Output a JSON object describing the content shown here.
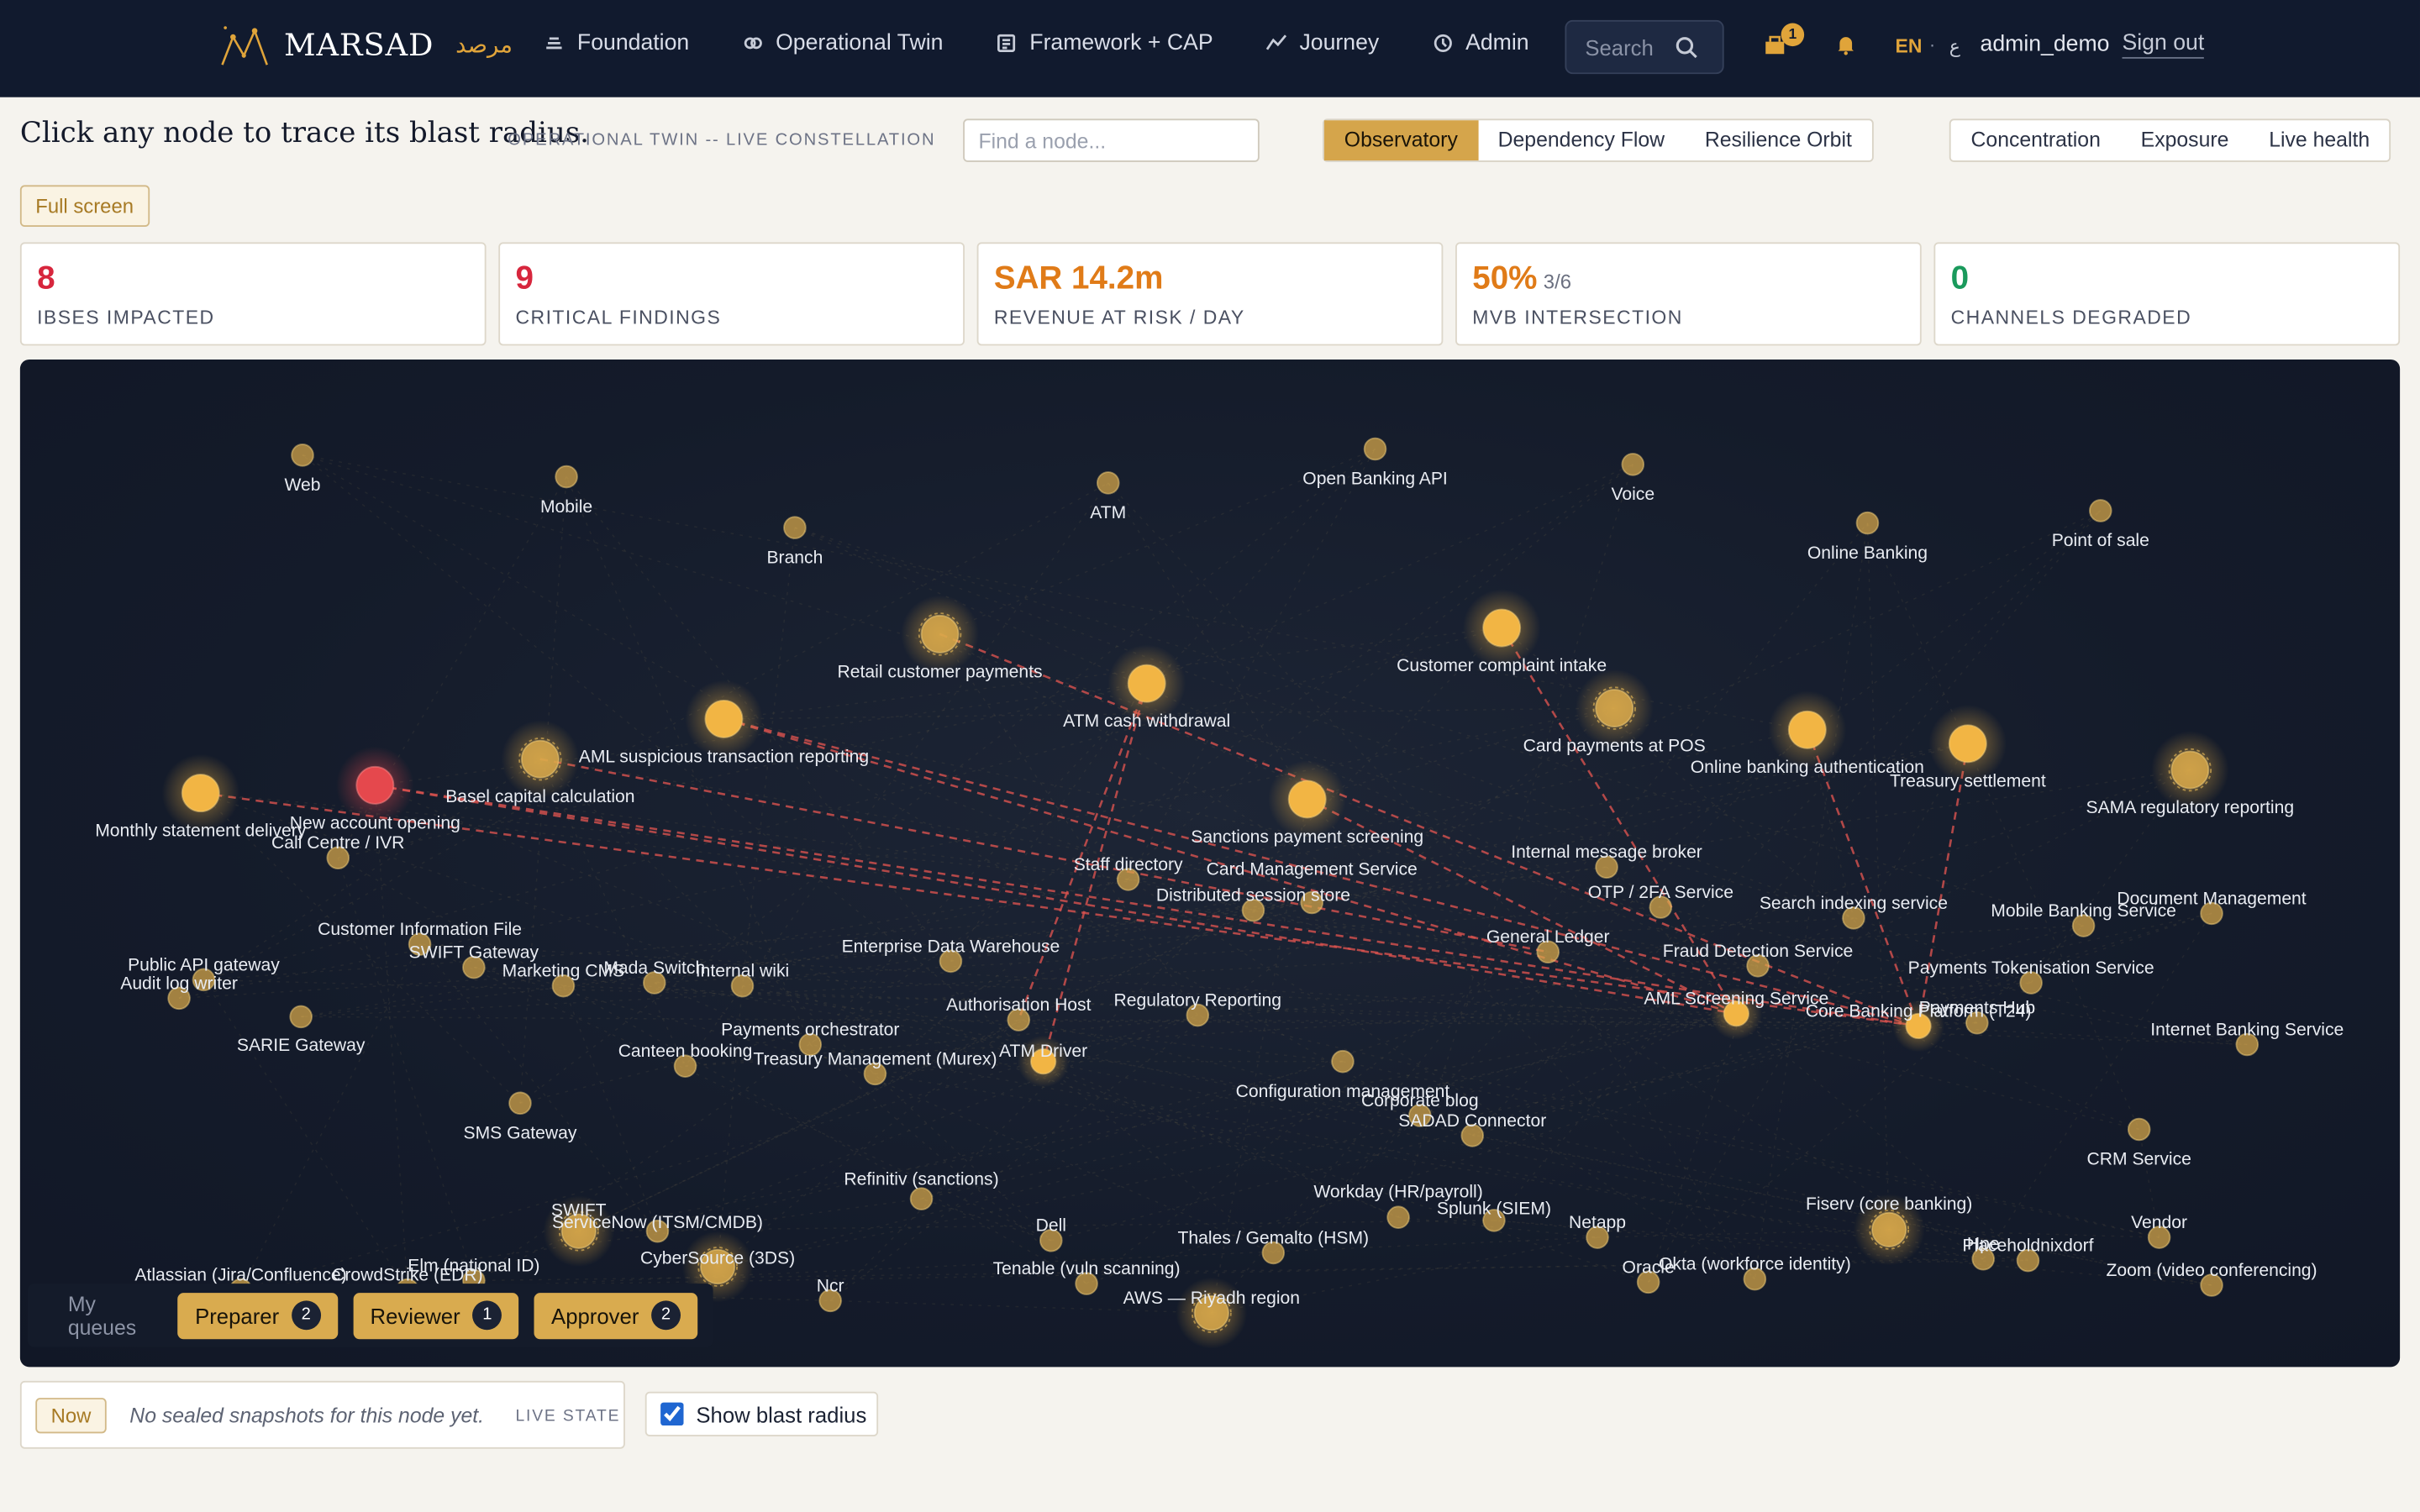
{
  "nav": {
    "brand": "MARSAD",
    "brand_ar": "مرصد",
    "links": [
      {
        "label": "Foundation",
        "icon": "layers-icon"
      },
      {
        "label": "Operational Twin",
        "icon": "twin-icon"
      },
      {
        "label": "Framework + CAP",
        "icon": "framework-icon"
      },
      {
        "label": "Journey",
        "icon": "journey-icon"
      },
      {
        "label": "Admin",
        "icon": "admin-icon"
      }
    ],
    "search_placeholder": "Search",
    "inbox_count": "1",
    "lang_en": "EN",
    "lang_sep": "·",
    "lang_ar": "ع",
    "user": "admin_demo",
    "signout": "Sign out"
  },
  "header": {
    "title": "Click any node to trace its blast radius.",
    "subtitle": "OPERATIONAL TWIN -- LIVE CONSTELLATION",
    "find_placeholder": "Find a node...",
    "views": [
      "Observatory",
      "Dependency Flow",
      "Resilience Orbit"
    ],
    "active_view": "Observatory",
    "lenses": [
      "Concentration",
      "Exposure",
      "Live health"
    ],
    "fullscreen": "Full screen"
  },
  "kpis": [
    {
      "value": "8",
      "fraction": "",
      "label": "IBSES IMPACTED",
      "color": "#d7263d"
    },
    {
      "value": "9",
      "fraction": "",
      "label": "CRITICAL FINDINGS",
      "color": "#d7263d"
    },
    {
      "value": "SAR 14.2m",
      "fraction": "",
      "label": "REVENUE AT RISK / DAY",
      "color": "#e07b18"
    },
    {
      "value": "50%",
      "fraction": "3/6",
      "label": "MVB INTERSECTION",
      "color": "#e07b18"
    },
    {
      "value": "0",
      "fraction": "",
      "label": "CHANNELS DEGRADED",
      "color": "#1a9a5c"
    }
  ],
  "colors": {
    "gold": "#d9a94b",
    "highlight": "#f2b544",
    "selected": "#e5484d",
    "blast_line": "#d9534f"
  },
  "graph": {
    "nodes": [
      {
        "id": "web",
        "label": "Web",
        "tier": "channel"
      },
      {
        "id": "mobile",
        "label": "Mobile",
        "tier": "channel"
      },
      {
        "id": "branch",
        "label": "Branch",
        "tier": "channel"
      },
      {
        "id": "atm",
        "label": "ATM",
        "tier": "channel"
      },
      {
        "id": "obapi",
        "label": "Open Banking API",
        "tier": "channel"
      },
      {
        "id": "voice",
        "label": "Voice",
        "tier": "channel"
      },
      {
        "id": "olb",
        "label": "Online Banking",
        "tier": "channel"
      },
      {
        "id": "pos",
        "label": "Point of sale",
        "tier": "channel"
      },
      {
        "id": "rcp",
        "label": "Retail customer payments",
        "tier": "ibs"
      },
      {
        "id": "cci",
        "label": "Customer complaint intake",
        "tier": "ibs",
        "hot": true
      },
      {
        "id": "atmcw",
        "label": "ATM cash withdrawal",
        "tier": "ibs",
        "hot": true
      },
      {
        "id": "aml",
        "label": "AML suspicious transaction reporting",
        "tier": "ibs",
        "hot": true
      },
      {
        "id": "cpos",
        "label": "Card payments at POS",
        "tier": "ibs"
      },
      {
        "id": "oba",
        "label": "Online banking authentication",
        "tier": "ibs",
        "hot": true
      },
      {
        "id": "ts",
        "label": "Treasury settlement",
        "tier": "ibs",
        "hot": true
      },
      {
        "id": "sama",
        "label": "SAMA regulatory reporting",
        "tier": "ibs"
      },
      {
        "id": "basel",
        "label": "Basel capital calculation",
        "tier": "ibs"
      },
      {
        "id": "mst",
        "label": "Monthly statement delivery",
        "tier": "ibs",
        "hot": true
      },
      {
        "id": "nao",
        "label": "New account opening",
        "tier": "ibs",
        "selected": true
      },
      {
        "id": "sps",
        "label": "Sanctions payment screening",
        "tier": "ibs",
        "hot": true
      },
      {
        "id": "cc",
        "label": "Call Centre / IVR",
        "tier": "app"
      },
      {
        "id": "staff",
        "label": "Staff directory",
        "tier": "app"
      },
      {
        "id": "dss",
        "label": "Distributed session store",
        "tier": "app"
      },
      {
        "id": "cms2",
        "label": "Card Management Service",
        "tier": "app"
      },
      {
        "id": "imb",
        "label": "Internal message broker",
        "tier": "app"
      },
      {
        "id": "otp",
        "label": "OTP / 2FA Service",
        "tier": "app"
      },
      {
        "id": "sis",
        "label": "Search indexing service",
        "tier": "app"
      },
      {
        "id": "mbs",
        "label": "Mobile Banking Service",
        "tier": "app"
      },
      {
        "id": "dm",
        "label": "Document Management",
        "tier": "app"
      },
      {
        "id": "cif",
        "label": "Customer Information File",
        "tier": "app"
      },
      {
        "id": "fds",
        "label": "Fraud Detection Service",
        "tier": "app"
      },
      {
        "id": "pag",
        "label": "Public API gateway",
        "tier": "app"
      },
      {
        "id": "alw",
        "label": "Audit log writer",
        "tier": "app"
      },
      {
        "id": "edw",
        "label": "Enterprise Data Warehouse",
        "tier": "app"
      },
      {
        "id": "gl",
        "label": "General Ledger",
        "tier": "app"
      },
      {
        "id": "amlss",
        "label": "AML Screening Service",
        "tier": "app",
        "hot": true
      },
      {
        "id": "cbp",
        "label": "Core Banking Platform (T24)",
        "tier": "app",
        "hot": true
      },
      {
        "id": "swg",
        "label": "SWIFT Gateway",
        "tier": "app"
      },
      {
        "id": "mcms",
        "label": "Marketing CMS",
        "tier": "app"
      },
      {
        "id": "madas",
        "label": "Mada Switch",
        "tier": "app"
      },
      {
        "id": "iwiki",
        "label": "Internal wiki",
        "tier": "app"
      },
      {
        "id": "porch",
        "label": "Payments orchestrator",
        "tier": "app"
      },
      {
        "id": "regrep",
        "label": "Regulatory Reporting",
        "tier": "app"
      },
      {
        "id": "pts",
        "label": "Payments Tokenisation Service",
        "tier": "app"
      },
      {
        "id": "phub",
        "label": "Payments Hub",
        "tier": "app"
      },
      {
        "id": "ibs2",
        "label": "Internet Banking Service",
        "tier": "app"
      },
      {
        "id": "sarie",
        "label": "SARIE Gateway",
        "tier": "app"
      },
      {
        "id": "canteen",
        "label": "Canteen booking",
        "tier": "app"
      },
      {
        "id": "tmm",
        "label": "Treasury Management (Murex)",
        "tier": "app"
      },
      {
        "id": "auth",
        "label": "Authorisation Host",
        "tier": "app"
      },
      {
        "id": "atmd",
        "label": "ATM Driver",
        "tier": "app",
        "hot": true
      },
      {
        "id": "cfgm",
        "label": "Configuration management",
        "tier": "app"
      },
      {
        "id": "cblog",
        "label": "Corporate blog",
        "tier": "app"
      },
      {
        "id": "sadad",
        "label": "SADAD Connector",
        "tier": "app"
      },
      {
        "id": "smsg",
        "label": "SMS Gateway",
        "tier": "app"
      },
      {
        "id": "crms",
        "label": "CRM Service",
        "tier": "app"
      },
      {
        "id": "refin",
        "label": "Refinitiv (sanctions)",
        "tier": "vendor"
      },
      {
        "id": "swift",
        "label": "SWIFT",
        "tier": "vendor"
      },
      {
        "id": "snow",
        "label": "ServiceNow (ITSM/CMDB)",
        "tier": "vendor"
      },
      {
        "id": "cys",
        "label": "CyberSource (3DS)",
        "tier": "vendor"
      },
      {
        "id": "dell",
        "label": "Dell",
        "tier": "vendor"
      },
      {
        "id": "wday",
        "label": "Workday (HR/payroll)",
        "tier": "vendor"
      },
      {
        "id": "splunk",
        "label": "Splunk (SIEM)",
        "tier": "vendor"
      },
      {
        "id": "netapp",
        "label": "Netapp",
        "tier": "vendor"
      },
      {
        "id": "fiserv",
        "label": "Fiserv (core banking)",
        "tier": "vendor"
      },
      {
        "id": "thales",
        "label": "Thales / Gemalto (HSM)",
        "tier": "vendor"
      },
      {
        "id": "tenable",
        "label": "Tenable (vuln scanning)",
        "tier": "vendor"
      },
      {
        "id": "oracle",
        "label": "Oracle",
        "tier": "vendor"
      },
      {
        "id": "okta",
        "label": "Okta (workforce identity)",
        "tier": "vendor"
      },
      {
        "id": "hpe",
        "label": "Hpe",
        "tier": "vendor"
      },
      {
        "id": "placeh",
        "label": "Placeholdnixdorf",
        "tier": "vendor"
      },
      {
        "id": "vendor",
        "label": "Vendor",
        "tier": "vendor"
      },
      {
        "id": "zoom",
        "label": "Zoom (video conferencing)",
        "tier": "vendor"
      },
      {
        "id": "atl",
        "label": "Atlassian (Jira/Confluence)",
        "tier": "vendor"
      },
      {
        "id": "crowd",
        "label": "CrowdStrike (EDR)",
        "tier": "vendor"
      },
      {
        "id": "elm",
        "label": "Elm (national ID)",
        "tier": "vendor"
      },
      {
        "id": "ncr",
        "label": "Ncr",
        "tier": "vendor"
      },
      {
        "id": "aws",
        "label": "AWS — Riyadh region",
        "tier": "vendor"
      }
    ],
    "blast_edges": [
      [
        "mst",
        "cbp"
      ],
      [
        "nao",
        "cbp"
      ],
      [
        "nao",
        "amlss"
      ],
      [
        "aml",
        "cbp"
      ],
      [
        "aml",
        "amlss"
      ],
      [
        "basel",
        "gl"
      ],
      [
        "sps",
        "amlss"
      ],
      [
        "atmcw",
        "auth"
      ],
      [
        "atmcw",
        "atmd"
      ],
      [
        "cci",
        "amlss"
      ],
      [
        "oba",
        "cbp"
      ],
      [
        "ts",
        "cbp"
      ],
      [
        "rcp",
        "cbp"
      ]
    ]
  },
  "queues": {
    "label": "My queues",
    "items": [
      {
        "label": "Preparer",
        "count": "2"
      },
      {
        "label": "Reviewer",
        "count": "1"
      },
      {
        "label": "Approver",
        "count": "2"
      }
    ]
  },
  "footer": {
    "now": "Now",
    "no_snapshots": "No sealed snapshots for this node yet.",
    "live_state": "LIVE STATE",
    "show_blast": "Show blast radius",
    "show_blast_checked": true
  }
}
